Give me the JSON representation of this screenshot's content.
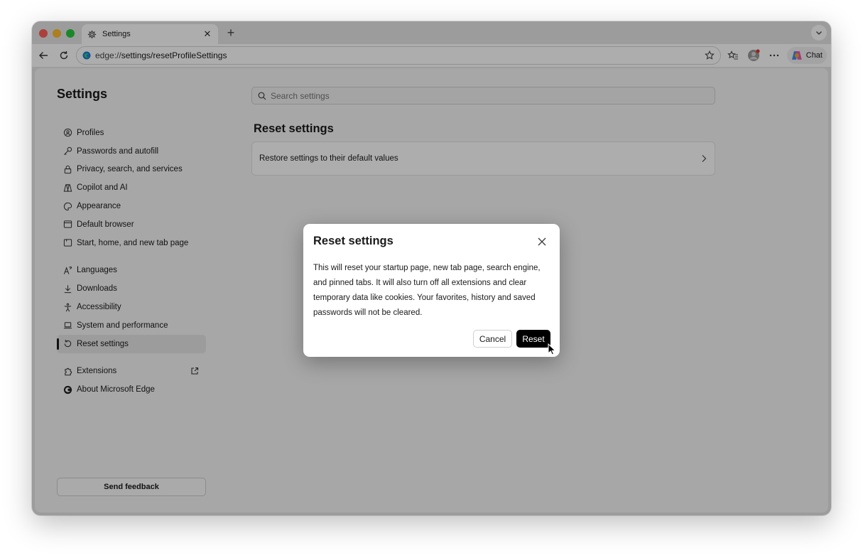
{
  "browser": {
    "tab_title": "Settings",
    "address_prefix": "edge://",
    "address_path": "settings/resetProfileSettings",
    "chat_label": "Chat"
  },
  "settings": {
    "title": "Settings",
    "search_placeholder": "Search settings",
    "nav_group1": [
      {
        "label": "Profiles",
        "icon": "profiles-icon"
      },
      {
        "label": "Passwords and autofill",
        "icon": "key-icon"
      },
      {
        "label": "Privacy, search, and services",
        "icon": "lock-icon"
      },
      {
        "label": "Copilot and AI",
        "icon": "copilot-icon"
      },
      {
        "label": "Appearance",
        "icon": "appearance-icon"
      },
      {
        "label": "Default browser",
        "icon": "browser-icon"
      },
      {
        "label": "Start, home, and new tab page",
        "icon": "home-icon"
      }
    ],
    "nav_group2": [
      {
        "label": "Languages",
        "icon": "languages-icon"
      },
      {
        "label": "Downloads",
        "icon": "download-icon"
      },
      {
        "label": "Accessibility",
        "icon": "accessibility-icon"
      },
      {
        "label": "System and performance",
        "icon": "laptop-icon"
      },
      {
        "label": "Reset settings",
        "icon": "reset-icon",
        "active": true
      }
    ],
    "nav_group3": [
      {
        "label": "Extensions",
        "icon": "extensions-icon"
      },
      {
        "label": "About Microsoft Edge",
        "icon": "edge-logo-icon"
      }
    ],
    "feedback_label": "Send feedback",
    "section_title": "Reset settings",
    "card_label": "Restore settings to their default values"
  },
  "dialog": {
    "title": "Reset settings",
    "body": "This will reset your startup page, new tab page, search engine, and pinned tabs. It will also turn off all extensions and clear temporary data like cookies. Your favorites, history and saved passwords will not be cleared.",
    "cancel_label": "Cancel",
    "reset_label": "Reset"
  }
}
